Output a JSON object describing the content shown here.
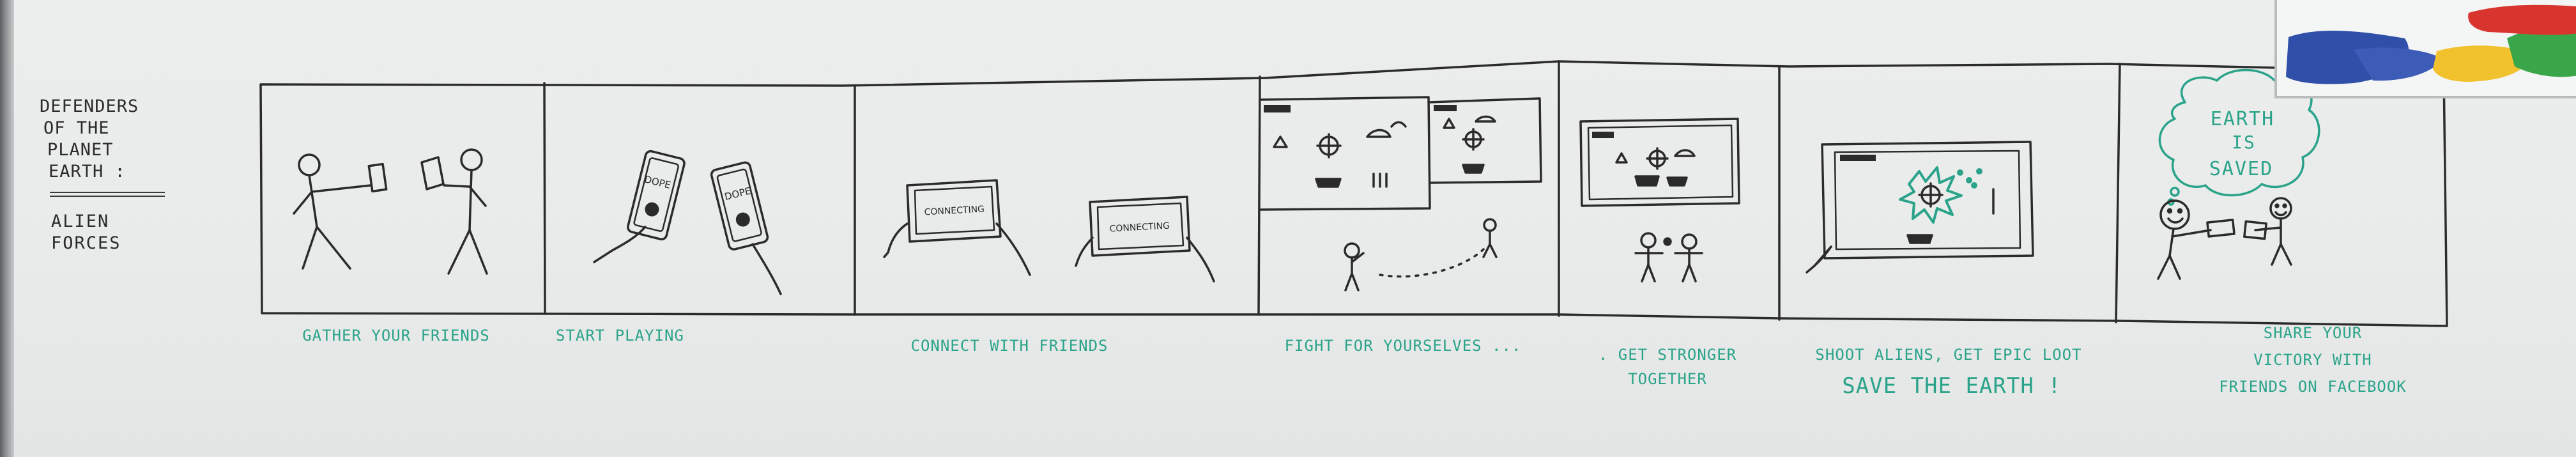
{
  "title": {
    "lines": [
      "Defenders",
      "of the",
      "Planet",
      "Earth :"
    ],
    "subtitle_lines": [
      "Alien",
      "Forces"
    ]
  },
  "panels": [
    {
      "caption_lines": [
        "Gather your friends"
      ]
    },
    {
      "caption_lines": [
        "Start playing"
      ],
      "phone_screen_text": [
        "DOPE",
        "DOPE"
      ]
    },
    {
      "caption_lines": [
        "Connect with friends"
      ],
      "tablet_screen_text": [
        "CONNECTING",
        "CONNECTING"
      ]
    },
    {
      "caption_lines": [
        "Fight for yourselves ..."
      ]
    },
    {
      "caption_lines": [
        ". Get stronger",
        "together"
      ]
    },
    {
      "caption_lines": [
        "Shoot aliens, get epic loot"
      ],
      "emphasis_line": "Save the Earth !"
    },
    {
      "caption_lines": [
        "Share your",
        "victory with",
        "friends on Facebook"
      ],
      "speech_bubble_lines": [
        "Earth",
        "is",
        "saved"
      ]
    }
  ],
  "colors": {
    "whiteboard": "#eceeed",
    "marker_black": "#2b2b2b",
    "marker_green": "#2aa38a",
    "sample_blue": "#2f4fa8",
    "sample_yellow": "#f2c12e",
    "sample_green": "#3aa64a",
    "sample_red": "#d9352f"
  }
}
